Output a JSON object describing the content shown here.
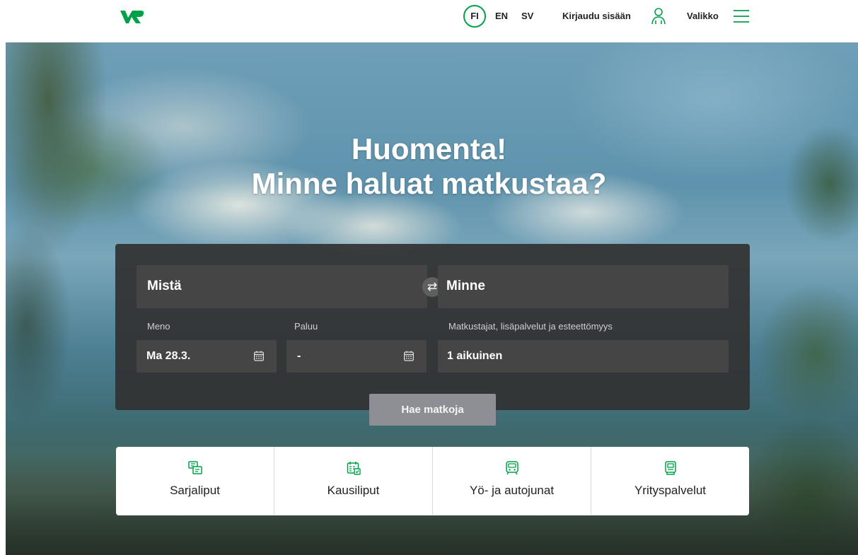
{
  "header": {
    "logo_alt": "VR",
    "languages": [
      "FI",
      "EN",
      "SV"
    ],
    "active_language": "FI",
    "login_label": "Kirjaudu sisään",
    "menu_label": "Valikko"
  },
  "hero": {
    "greeting": "Huomenta!",
    "question": "Minne haluat matkustaa?"
  },
  "search": {
    "from_placeholder": "Mistä",
    "to_placeholder": "Minne",
    "swap_icon": "swap-arrows-icon",
    "departure_label": "Meno",
    "departure_value": "Ma 28.3.",
    "return_label": "Paluu",
    "return_value": "-",
    "travellers_label": "Matkustajat, lisäpalvelut ja esteettömyys",
    "travellers_value": "1 aikuinen",
    "submit_label": "Hae matkoja"
  },
  "quick_links": [
    {
      "label": "Sarjaliput",
      "icon": "multi-ticket-icon"
    },
    {
      "label": "Kausiliput",
      "icon": "season-ticket-icon"
    },
    {
      "label": "Yö- ja autojunat",
      "icon": "night-train-icon"
    },
    {
      "label": "Yrityspalvelut",
      "icon": "business-icon"
    }
  ],
  "colors": {
    "brand_green": "#00a149",
    "panel_bg": "#323232",
    "field_bg": "#454545",
    "button_bg": "#8e8f94"
  }
}
